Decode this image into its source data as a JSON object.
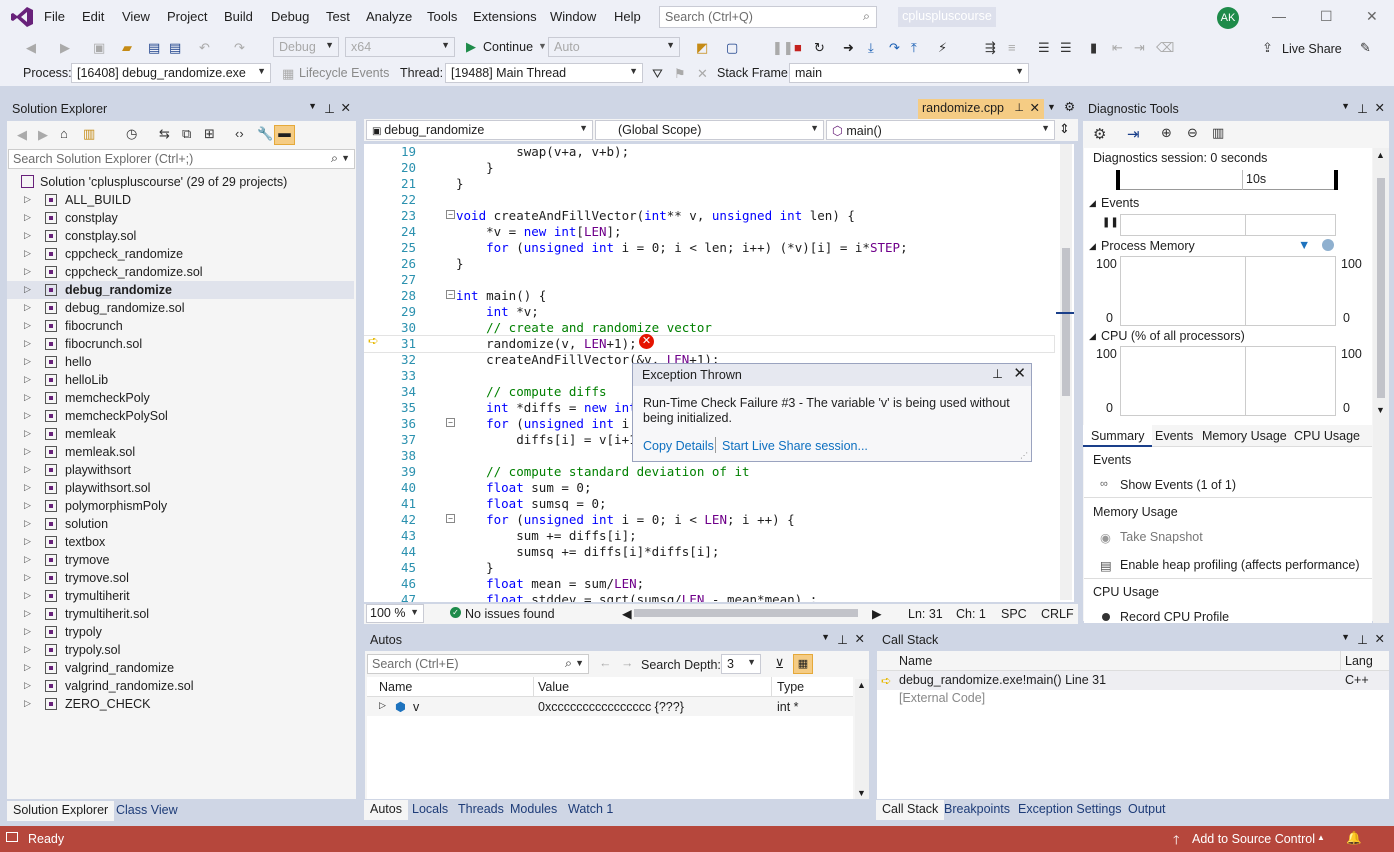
{
  "menu": {
    "items": [
      "File",
      "Edit",
      "View",
      "Project",
      "Build",
      "Debug",
      "Test",
      "Analyze",
      "Tools",
      "Extensions",
      "Window",
      "Help"
    ],
    "search_placeholder": "Search (Ctrl+Q)",
    "solution_name": "cpluspluscourse",
    "avatar_initials": "AK"
  },
  "toolbar": {
    "config": "Debug",
    "platform": "x64",
    "continue_label": "Continue",
    "auto_combo": "Auto",
    "live_share": "Live Share"
  },
  "debug_bar": {
    "process_label": "Process:",
    "process_value": "[16408] debug_randomize.exe",
    "lifecycle_label": "Lifecycle Events",
    "thread_label": "Thread:",
    "thread_value": "[19488] Main Thread",
    "stack_frame_label": "Stack Frame:",
    "stack_frame_value": "main"
  },
  "solution_explorer": {
    "title": "Solution Explorer",
    "search_placeholder": "Search Solution Explorer (Ctrl+;)",
    "root": "Solution 'cpluspluscourse' (29 of 29 projects)",
    "projects": [
      "ALL_BUILD",
      "constplay",
      "constplay.sol",
      "cppcheck_randomize",
      "cppcheck_randomize.sol",
      "debug_randomize",
      "debug_randomize.sol",
      "fibocrunch",
      "fibocrunch.sol",
      "hello",
      "helloLib",
      "memcheckPoly",
      "memcheckPolySol",
      "memleak",
      "memleak.sol",
      "playwithsort",
      "playwithsort.sol",
      "polymorphismPoly",
      "solution",
      "textbox",
      "trymove",
      "trymove.sol",
      "trymultiherit",
      "trymultiherit.sol",
      "trypoly",
      "trypoly.sol",
      "valgrind_randomize",
      "valgrind_randomize.sol",
      "ZERO_CHECK"
    ],
    "selected": "debug_randomize",
    "tabs": [
      "Solution Explorer",
      "Class View"
    ]
  },
  "editor": {
    "tab_label": "randomize.cpp",
    "project_combo": "debug_randomize",
    "scope_combo": "(Global Scope)",
    "member_combo": "main()",
    "lines": [
      {
        "n": "19",
        "t": "        swap(v+a, v+b);",
        "fold": ""
      },
      {
        "n": "20",
        "t": "    }",
        "fold": ""
      },
      {
        "n": "21",
        "t": "}",
        "fold": ""
      },
      {
        "n": "22",
        "t": "",
        "fold": ""
      },
      {
        "n": "23",
        "t": "void createAndFillVector(int** v, unsigned int len) {",
        "fold": "−"
      },
      {
        "n": "24",
        "t": "    *v = new int[LEN];",
        "fold": ""
      },
      {
        "n": "25",
        "t": "    for (unsigned int i = 0; i < len; i++) (*v)[i] = i*STEP;",
        "fold": ""
      },
      {
        "n": "26",
        "t": "}",
        "fold": ""
      },
      {
        "n": "27",
        "t": "",
        "fold": ""
      },
      {
        "n": "28",
        "t": "int main() {",
        "fold": "−"
      },
      {
        "n": "29",
        "t": "    int *v;",
        "fold": ""
      },
      {
        "n": "30",
        "t": "    // create and randomize vector",
        "fold": ""
      },
      {
        "n": "31",
        "t": "    randomize(v, LEN+1);",
        "fold": ""
      },
      {
        "n": "32",
        "t": "    createAndFillVector(&v, LEN+1);",
        "fold": ""
      },
      {
        "n": "33",
        "t": "",
        "fold": ""
      },
      {
        "n": "34",
        "t": "    // compute diffs",
        "fold": ""
      },
      {
        "n": "35",
        "t": "    int *diffs = new int[",
        "fold": ""
      },
      {
        "n": "36",
        "t": "    for (unsigned int i =",
        "fold": "−"
      },
      {
        "n": "37",
        "t": "        diffs[i] = v[i+1]",
        "fold": ""
      },
      {
        "n": "38",
        "t": "",
        "fold": ""
      },
      {
        "n": "39",
        "t": "    // compute standard deviation of it",
        "fold": ""
      },
      {
        "n": "40",
        "t": "    float sum = 0;",
        "fold": ""
      },
      {
        "n": "41",
        "t": "    float sumsq = 0;",
        "fold": ""
      },
      {
        "n": "42",
        "t": "    for (unsigned int i = 0; i < LEN; i ++) {",
        "fold": "−"
      },
      {
        "n": "43",
        "t": "        sum += diffs[i];",
        "fold": ""
      },
      {
        "n": "44",
        "t": "        sumsq += diffs[i]*diffs[i];",
        "fold": ""
      },
      {
        "n": "45",
        "t": "    }",
        "fold": ""
      },
      {
        "n": "46",
        "t": "    float mean = sum/LEN;",
        "fold": ""
      },
      {
        "n": "47",
        "t": "    float stddev = sqrt(sumsq/LEN - mean*mean) ;",
        "fold": ""
      }
    ],
    "zoom": "100 %",
    "issues": "No issues found",
    "ln": "Ln: 31",
    "ch": "Ch: 1",
    "spc": "SPC",
    "crlf": "CRLF"
  },
  "exception": {
    "title": "Exception Thrown",
    "message": "Run-Time Check Failure #3 - The variable 'v' is being used without being initialized.",
    "copy_details": "Copy Details",
    "live_share": "Start Live Share session..."
  },
  "diagnostic": {
    "title": "Diagnostic Tools",
    "session": "Diagnostics session: 0 seconds",
    "timeline_label": "10s",
    "events_header": "Events",
    "process_memory": "Process Memory",
    "pm_max_left": "100",
    "pm_min_left": "0",
    "pm_max_right": "100",
    "pm_min_right": "0",
    "cpu_header": "CPU (% of all processors)",
    "cpu_max_left": "100",
    "cpu_min_left": "0",
    "cpu_max_right": "100",
    "cpu_min_right": "0",
    "tabs": [
      "Summary",
      "Events",
      "Memory Usage",
      "CPU Usage"
    ],
    "sec_events": "Events",
    "show_events": "Show Events (1 of 1)",
    "sec_memory": "Memory Usage",
    "take_snapshot": "Take Snapshot",
    "heap_profiling": "Enable heap profiling (affects performance)",
    "sec_cpu": "CPU Usage",
    "record_cpu": "Record CPU Profile"
  },
  "autos": {
    "title": "Autos",
    "search_placeholder": "Search (Ctrl+E)",
    "depth_label": "Search Depth:",
    "depth_value": "3",
    "headers": [
      "Name",
      "Value",
      "Type"
    ],
    "rows": [
      {
        "name": "v",
        "value": "0xcccccccccccccccc {???}",
        "type": "int *"
      }
    ],
    "tabs": [
      "Autos",
      "Locals",
      "Threads",
      "Modules",
      "Watch 1"
    ]
  },
  "callstack": {
    "title": "Call Stack",
    "headers": [
      "Name",
      "Lang"
    ],
    "rows": [
      {
        "name": "debug_randomize.exe!main() Line 31",
        "lang": "C++"
      },
      {
        "name": "[External Code]",
        "lang": ""
      }
    ],
    "tabs": [
      "Call Stack",
      "Breakpoints",
      "Exception Settings",
      "Output"
    ]
  },
  "status": {
    "text": "Ready",
    "source_control": "Add to Source Control",
    "color": "#b6473c"
  }
}
